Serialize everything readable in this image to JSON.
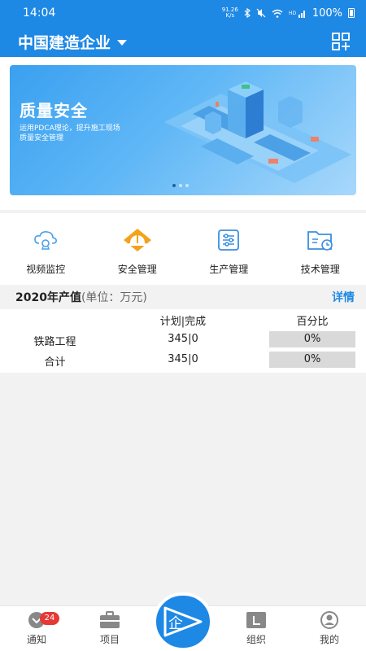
{
  "status_bar": {
    "time": "14:04",
    "net_speed_top": "91.26",
    "net_speed_bottom": "K/s",
    "battery": "100%"
  },
  "header": {
    "company": "中国建造企业",
    "scan_icon": "qr-add-icon"
  },
  "banner": {
    "title": "质量安全",
    "desc_line1": "运用PDCA理论，提升施工现场",
    "desc_line2": "质量安全管理",
    "slides": 3,
    "active_slide": 1
  },
  "functions": [
    {
      "label": "视频监控",
      "icon": "cloud-camera-icon"
    },
    {
      "label": "安全管理",
      "icon": "hardhat-icon"
    },
    {
      "label": "生产管理",
      "icon": "sliders-icon"
    },
    {
      "label": "技术管理",
      "icon": "folder-icon"
    }
  ],
  "output": {
    "title": "2020年产值",
    "unit": "(单位：万元)",
    "detail": "详情",
    "col_plan": "计划|完成",
    "col_pct": "百分比",
    "rows": [
      {
        "name": "铁路工程",
        "plan": "345|0",
        "pct": "0%"
      },
      {
        "name": "合计",
        "plan": "345|0",
        "pct": "0%"
      }
    ]
  },
  "nav": {
    "notice": "通知",
    "notice_badge": "24",
    "project": "项目",
    "center": "企",
    "org": "组织",
    "mine": "我的"
  },
  "colors": {
    "primary": "#1e88e5",
    "badge": "#e53935",
    "hardhat": "#f2a31b"
  }
}
